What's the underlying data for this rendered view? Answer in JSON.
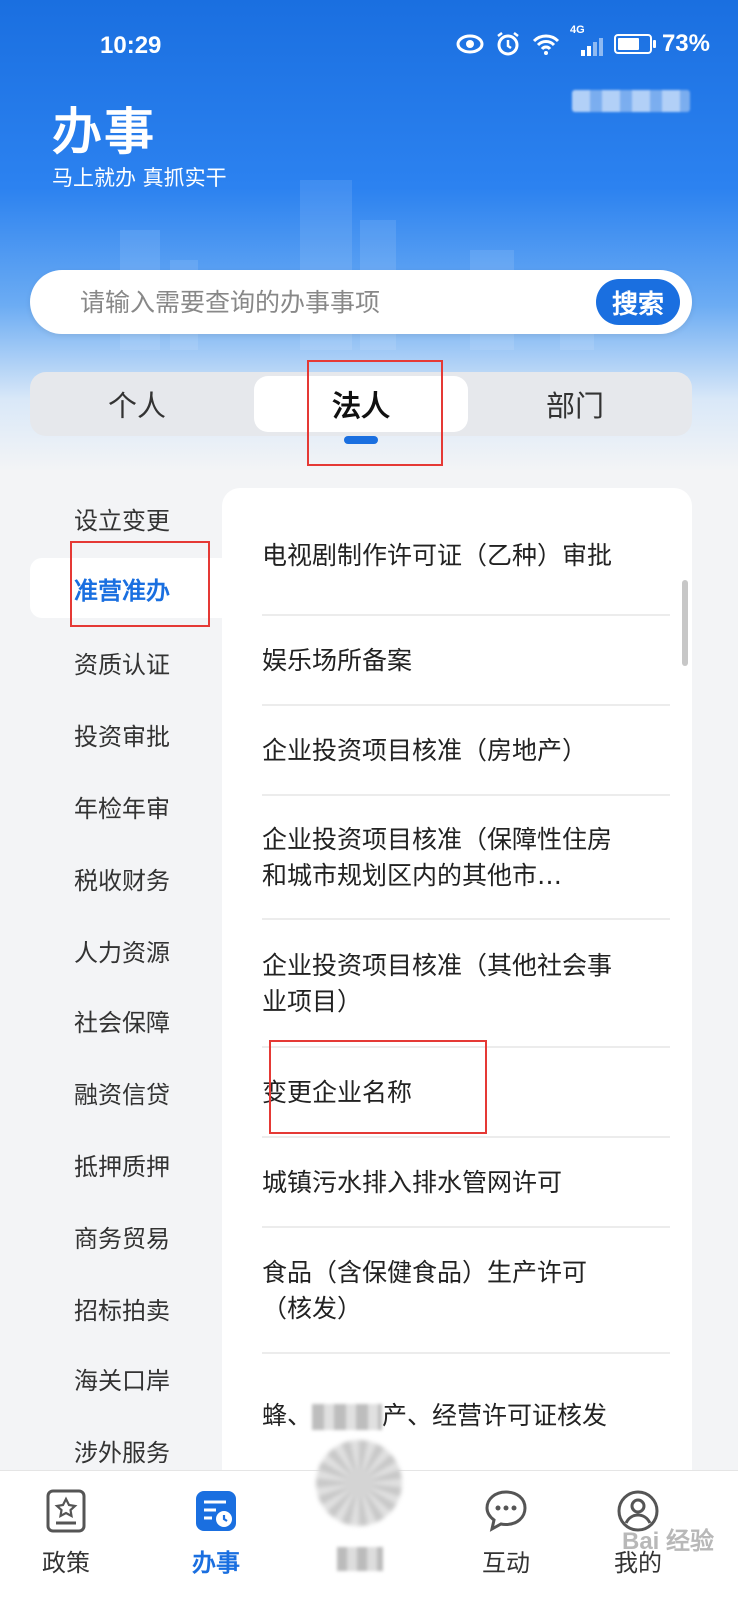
{
  "status_bar": {
    "time": "10:29",
    "network": "4G",
    "battery_percent": "73%",
    "battery_level": 0.73,
    "icons": [
      "eye-icon",
      "alarm-icon",
      "wifi-icon",
      "signal-icon",
      "battery-icon"
    ]
  },
  "header": {
    "title": "办事",
    "slogan": "马上就办  真抓实干"
  },
  "search": {
    "placeholder": "请输入需要查询的办事事项",
    "button_label": "搜索"
  },
  "segments": [
    {
      "label": "个人",
      "active": false
    },
    {
      "label": "法人",
      "active": true
    },
    {
      "label": "部门",
      "active": false
    }
  ],
  "categories": [
    {
      "label": "设立变更",
      "active": false
    },
    {
      "label": "准营准办",
      "active": true
    },
    {
      "label": "资质认证",
      "active": false
    },
    {
      "label": "投资审批",
      "active": false
    },
    {
      "label": "年检年审",
      "active": false
    },
    {
      "label": "税收财务",
      "active": false
    },
    {
      "label": "人力资源",
      "active": false
    },
    {
      "label": "社会保障",
      "active": false
    },
    {
      "label": "融资信贷",
      "active": false
    },
    {
      "label": "抵押质押",
      "active": false
    },
    {
      "label": "商务贸易",
      "active": false
    },
    {
      "label": "招标拍卖",
      "active": false
    },
    {
      "label": "海关口岸",
      "active": false
    },
    {
      "label": "涉外服务",
      "active": false
    }
  ],
  "services": [
    {
      "label": "电视剧制作许可证（乙种）审批"
    },
    {
      "label": "娱乐场所备案"
    },
    {
      "label": "企业投资项目核准（房地产）"
    },
    {
      "label": "企业投资项目核准（保障性住房和城市规划区内的其他市…"
    },
    {
      "label": "企业投资项目核准（其他社会事业项目）"
    },
    {
      "label": "变更企业名称"
    },
    {
      "label": "城镇污水排入排水管网许可"
    },
    {
      "label": "食品（含保健食品）生产许可（核发）"
    },
    {
      "label_start": "蜂、",
      "label_end": "产、经营许可证核发"
    }
  ],
  "bottom_nav": [
    {
      "label": "政策",
      "icon": "policy-icon",
      "active": false
    },
    {
      "label": "办事",
      "icon": "affairs-icon",
      "active": true
    },
    {
      "label": "",
      "icon": "center-icon",
      "active": false
    },
    {
      "label": "互动",
      "icon": "chat-icon",
      "active": false
    },
    {
      "label": "我的",
      "icon": "profile-icon",
      "active": false
    }
  ],
  "watermark": "Bai 经验"
}
